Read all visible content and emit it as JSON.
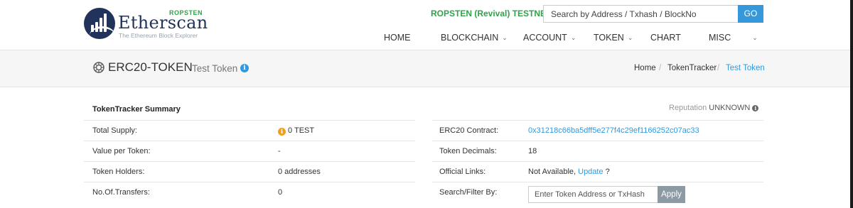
{
  "header": {
    "logo": {
      "name": "Etherscan",
      "network_badge": "ROPSTEN",
      "tagline": "The Ethereum Block Explorer"
    },
    "network_label": "ROPSTEN (Revival) TESTNET",
    "search": {
      "placeholder": "Search by Address / Txhash / BlockNo",
      "value": "",
      "button_label": "GO"
    },
    "nav": [
      {
        "label": "HOME",
        "has_dropdown": false
      },
      {
        "label": "BLOCKCHAIN",
        "has_dropdown": true
      },
      {
        "label": "ACCOUNT",
        "has_dropdown": true
      },
      {
        "label": "TOKEN",
        "has_dropdown": true
      },
      {
        "label": "CHART",
        "has_dropdown": false
      },
      {
        "label": "MISC",
        "has_dropdown": true
      }
    ],
    "dropdown_glyph": "⌄"
  },
  "title_band": {
    "icon": "erc20-token-icon",
    "title": "ERC20-TOKEN",
    "subtitle": "Test Token",
    "info_glyph": "i",
    "breadcrumb": [
      "Home",
      "TokenTracker",
      "Test Token"
    ],
    "breadcrumb_separator": "/"
  },
  "summary": {
    "title": "TokenTracker Summary",
    "reputation_label": "Reputation",
    "reputation_value": "UNKNOWN",
    "left_rows": [
      {
        "label": "Total Supply:",
        "value": "0 TEST",
        "has_info_icon": true
      },
      {
        "label": "Value per Token:",
        "value": "-"
      },
      {
        "label": "Token Holders:",
        "value": "0 addresses"
      },
      {
        "label": "No.Of.Transfers:",
        "value": "0"
      }
    ],
    "right_rows": [
      {
        "label": "ERC20 Contract:",
        "value": "0x31218c66ba5dff5e277f4c29ef1166252c07ac33"
      },
      {
        "label": "Token Decimals:",
        "value": "18"
      },
      {
        "label": "Official Links:",
        "value_prefix": "Not Available, ",
        "value_link": "Update",
        "value_suffix": " ?"
      },
      {
        "label": "Search/Filter By:"
      }
    ],
    "filter": {
      "placeholder": "Enter Token Address or TxHash",
      "value": "",
      "button_label": "Apply"
    }
  },
  "colors": {
    "brand_navy": "#21325b",
    "testnet_green": "#2fa24a",
    "link_blue": "#3498db",
    "info_orange": "#f0a01e",
    "apply_grey": "#8c9aa3"
  }
}
